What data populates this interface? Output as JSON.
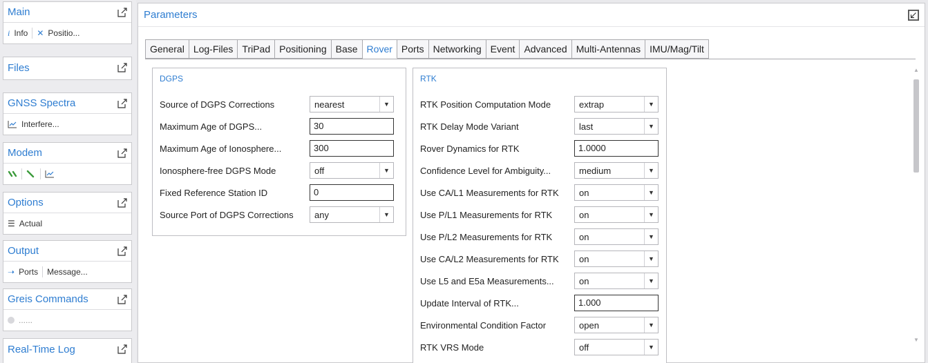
{
  "sidebar": {
    "main": {
      "title": "Main",
      "items": [
        "Info",
        "Positio..."
      ]
    },
    "files": {
      "title": "Files"
    },
    "gnss": {
      "title": "GNSS Spectra",
      "items": [
        "Interfere..."
      ]
    },
    "modem": {
      "title": "Modem"
    },
    "options": {
      "title": "Options",
      "items": [
        "Actual"
      ]
    },
    "output": {
      "title": "Output",
      "items": [
        "Ports",
        "Message..."
      ]
    },
    "greis": {
      "title": "Greis Commands",
      "items": [
        "......"
      ]
    },
    "realtime": {
      "title": "Real-Time Log"
    }
  },
  "main": {
    "title": "Parameters",
    "tabs": [
      "General",
      "Log-Files",
      "TriPad",
      "Positioning",
      "Base",
      "Rover",
      "Ports",
      "Networking",
      "Event",
      "Advanced",
      "Multi-Antennas",
      "IMU/Mag/Tilt"
    ],
    "active_tab": "Rover"
  },
  "dgps": {
    "title": "DGPS",
    "rows": [
      {
        "label": "Source of DGPS Corrections",
        "value": "nearest",
        "kind": "select"
      },
      {
        "label": "Maximum Age of DGPS...",
        "value": "30",
        "kind": "input"
      },
      {
        "label": "Maximum Age of Ionosphere...",
        "value": "300",
        "kind": "input"
      },
      {
        "label": "Ionosphere-free DGPS Mode",
        "value": "off",
        "kind": "select"
      },
      {
        "label": "Fixed Reference Station ID",
        "value": "0",
        "kind": "input"
      },
      {
        "label": "Source Port of DGPS Corrections",
        "value": "any",
        "kind": "select"
      }
    ]
  },
  "rtk": {
    "title": "RTK",
    "rows": [
      {
        "label": "RTK Position Computation Mode",
        "value": "extrap",
        "kind": "select"
      },
      {
        "label": "RTK Delay Mode Variant",
        "value": "last",
        "kind": "select"
      },
      {
        "label": "Rover Dynamics for RTK",
        "value": "1.0000",
        "kind": "input"
      },
      {
        "label": "Confidence Level for Ambiguity...",
        "value": "medium",
        "kind": "select"
      },
      {
        "label": "Use CA/L1 Measurements for RTK",
        "value": "on",
        "kind": "select"
      },
      {
        "label": "Use P/L1 Measurements for RTK",
        "value": "on",
        "kind": "select"
      },
      {
        "label": "Use P/L2 Measurements for RTK",
        "value": "on",
        "kind": "select"
      },
      {
        "label": "Use CA/L2 Measurements for RTK",
        "value": "on",
        "kind": "select"
      },
      {
        "label": "Use L5 and E5a Measurements...",
        "value": "on",
        "kind": "select"
      },
      {
        "label": "Update Interval of RTK...",
        "value": "1.000",
        "kind": "input"
      },
      {
        "label": "Environmental Condition Factor",
        "value": "open",
        "kind": "select"
      },
      {
        "label": "RTK VRS Mode",
        "value": "off",
        "kind": "select"
      }
    ]
  }
}
